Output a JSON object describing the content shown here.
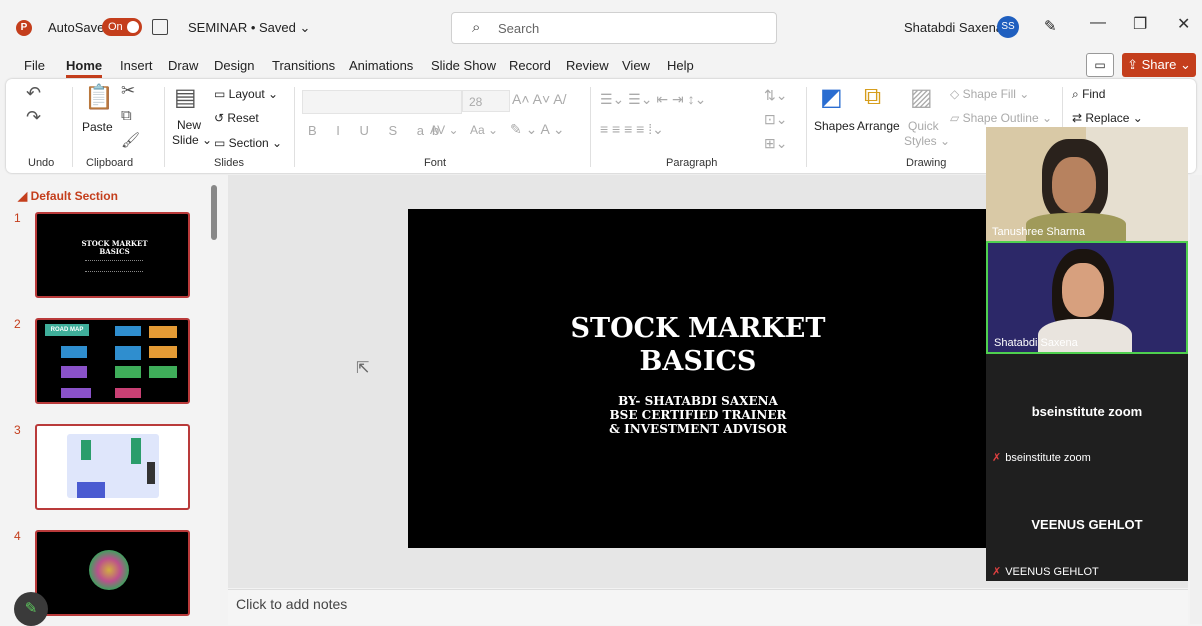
{
  "titlebar": {
    "app_icon": "P",
    "autosave_label": "AutoSave",
    "autosave_state": "On",
    "doc_title": "SEMINAR • Saved ⌄",
    "search_placeholder": "Search",
    "user_name": "Shatabdi Saxena",
    "user_initials": "SS"
  },
  "menu": {
    "items": [
      "File",
      "Home",
      "Insert",
      "Draw",
      "Design",
      "Transitions",
      "Animations",
      "Slide Show",
      "Record",
      "Review",
      "View",
      "Help"
    ],
    "share_label": "Share"
  },
  "ribbon": {
    "groups": {
      "undo": "Undo",
      "clipboard": "Clipboard",
      "slides": "Slides",
      "font": "Font",
      "paragraph": "Paragraph",
      "drawing": "Drawing"
    },
    "paste": "Paste",
    "new_slide_1": "New",
    "new_slide_2": "Slide ⌄",
    "layout": "Layout ⌄",
    "reset": "Reset",
    "section": "Section ⌄",
    "font_size": "28",
    "shapes": "Shapes",
    "arrange": "Arrange",
    "quick_styles_1": "Quick",
    "quick_styles_2": "Styles ⌄",
    "shape_fill": "Shape Fill ⌄",
    "shape_outline": "Shape Outline ⌄",
    "find": "Find",
    "replace": "Replace ⌄",
    "font_buttons": [
      "B",
      "I",
      "U",
      "S",
      "ab",
      "AV ⌄",
      "Aa ⌄"
    ]
  },
  "slides_pane": {
    "section_name": "Default Section",
    "numbers": [
      "1",
      "2",
      "3",
      "4"
    ],
    "thumb1_title": "STOCK MARKET BASICS",
    "thumb2_title": "ROAD MAP"
  },
  "slide": {
    "title_line1": "STOCK MARKET",
    "title_line2": "BASICS",
    "sub_line1": "BY- SHATABDI SAXENA",
    "sub_line2": "BSE CERTIFIED TRAINER",
    "sub_line3": "& INVESTMENT ADVISOR"
  },
  "notes_placeholder": "Click to add notes",
  "participants": [
    {
      "name": "Tanushree Sharma"
    },
    {
      "name": "Shatabdi Saxena"
    },
    {
      "name": "bseinstitute zoom",
      "label": "bseinstitute zoom"
    },
    {
      "name": "VEENUS GEHLOT",
      "label": "VEENUS GEHLOT"
    }
  ]
}
